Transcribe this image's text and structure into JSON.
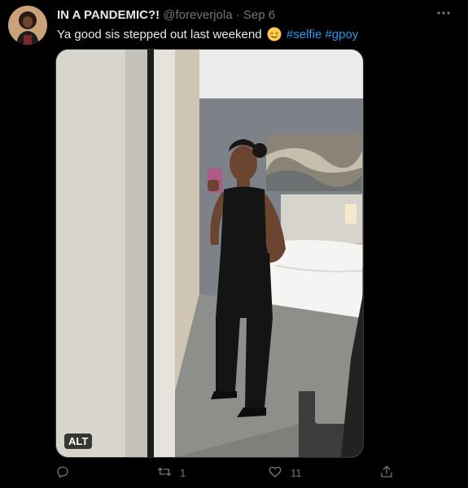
{
  "tweet": {
    "display_name": "IN A PANDEMIC?!",
    "handle": "@foreverjola",
    "separator": "·",
    "date": "Sep 6",
    "text_main": "Ya good sis stepped out last weekend",
    "emoji": "relieved-face-emoji",
    "hashtags": [
      "#selfie",
      "#gpoy"
    ],
    "media_alt_badge": "ALT"
  },
  "actions": {
    "reply_count": "",
    "retweet_count": "1",
    "like_count": "11"
  },
  "colors": {
    "background": "#000000",
    "text": "#e7e9ea",
    "muted": "#71767b",
    "link": "#1d9bf0",
    "emoji": "#ffcc4d"
  }
}
